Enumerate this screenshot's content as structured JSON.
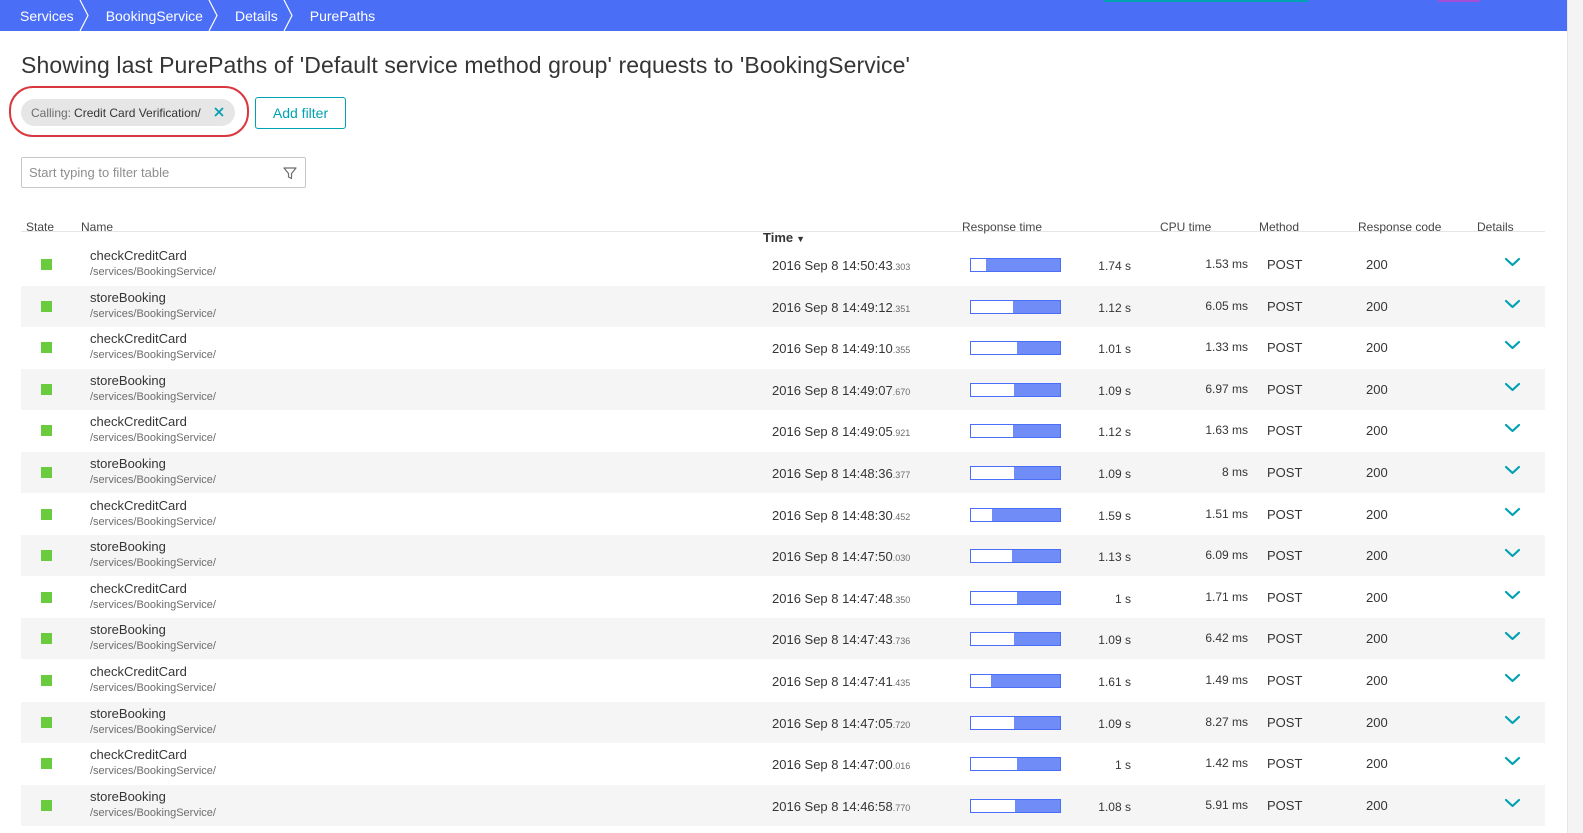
{
  "breadcrumb": [
    {
      "label": "Services"
    },
    {
      "label": "BookingService"
    },
    {
      "label": "Details"
    },
    {
      "label": "PurePaths"
    }
  ],
  "colors": {
    "topbar": "#4a6ef5",
    "accent": "#00a1b2",
    "highlight": "#d9383e",
    "state_ok": "#6bcb3f",
    "bar_fill": "#6f8cf7"
  },
  "page": {
    "title": "Showing last PurePaths of 'Default service method group' requests to 'BookingService'"
  },
  "filter_chip": {
    "key": "Calling:",
    "value": "Credit Card Verification/",
    "close_icon": "close-icon"
  },
  "add_filter_label": "Add filter",
  "search": {
    "placeholder": "Start typing to filter table",
    "icon": "funnel-icon"
  },
  "table": {
    "headers": {
      "state": "State",
      "name": "Name",
      "time": "Time",
      "response_time": "Response time",
      "cpu_time": "CPU time",
      "method": "Method",
      "response_code": "Response code",
      "details": "Details"
    },
    "sorted_by": "time",
    "sort_direction": "descending",
    "rows": [
      {
        "name": "checkCreditCard",
        "path": "/services/BookingService/",
        "time": "2016 Sep 8 14:50:43",
        "ms": ".303",
        "response_time": "1.74 s",
        "bar_fraction": 0.83,
        "cpu_time": "1.53 ms",
        "method": "POST",
        "code": "200"
      },
      {
        "name": "storeBooking",
        "path": "/services/BookingService/",
        "time": "2016 Sep 8 14:49:12",
        "ms": ".351",
        "response_time": "1.12 s",
        "bar_fraction": 0.53,
        "cpu_time": "6.05 ms",
        "method": "POST",
        "code": "200"
      },
      {
        "name": "checkCreditCard",
        "path": "/services/BookingService/",
        "time": "2016 Sep 8 14:49:10",
        "ms": ".355",
        "response_time": "1.01 s",
        "bar_fraction": 0.48,
        "cpu_time": "1.33 ms",
        "method": "POST",
        "code": "200"
      },
      {
        "name": "storeBooking",
        "path": "/services/BookingService/",
        "time": "2016 Sep 8 14:49:07",
        "ms": ".670",
        "response_time": "1.09 s",
        "bar_fraction": 0.52,
        "cpu_time": "6.97 ms",
        "method": "POST",
        "code": "200"
      },
      {
        "name": "checkCreditCard",
        "path": "/services/BookingService/",
        "time": "2016 Sep 8 14:49:05",
        "ms": ".921",
        "response_time": "1.12 s",
        "bar_fraction": 0.53,
        "cpu_time": "1.63 ms",
        "method": "POST",
        "code": "200"
      },
      {
        "name": "storeBooking",
        "path": "/services/BookingService/",
        "time": "2016 Sep 8 14:48:36",
        "ms": ".377",
        "response_time": "1.09 s",
        "bar_fraction": 0.52,
        "cpu_time": "8 ms",
        "method": "POST",
        "code": "200"
      },
      {
        "name": "checkCreditCard",
        "path": "/services/BookingService/",
        "time": "2016 Sep 8 14:48:30",
        "ms": ".452",
        "response_time": "1.59 s",
        "bar_fraction": 0.76,
        "cpu_time": "1.51 ms",
        "method": "POST",
        "code": "200"
      },
      {
        "name": "storeBooking",
        "path": "/services/BookingService/",
        "time": "2016 Sep 8 14:47:50",
        "ms": ".030",
        "response_time": "1.13 s",
        "bar_fraction": 0.54,
        "cpu_time": "6.09 ms",
        "method": "POST",
        "code": "200"
      },
      {
        "name": "checkCreditCard",
        "path": "/services/BookingService/",
        "time": "2016 Sep 8 14:47:48",
        "ms": ".350",
        "response_time": "1 s",
        "bar_fraction": 0.48,
        "cpu_time": "1.71 ms",
        "method": "POST",
        "code": "200"
      },
      {
        "name": "storeBooking",
        "path": "/services/BookingService/",
        "time": "2016 Sep 8 14:47:43",
        "ms": ".736",
        "response_time": "1.09 s",
        "bar_fraction": 0.52,
        "cpu_time": "6.42 ms",
        "method": "POST",
        "code": "200"
      },
      {
        "name": "checkCreditCard",
        "path": "/services/BookingService/",
        "time": "2016 Sep 8 14:47:41",
        "ms": ".435",
        "response_time": "1.61 s",
        "bar_fraction": 0.77,
        "cpu_time": "1.49 ms",
        "method": "POST",
        "code": "200"
      },
      {
        "name": "storeBooking",
        "path": "/services/BookingService/",
        "time": "2016 Sep 8 14:47:05",
        "ms": ".720",
        "response_time": "1.09 s",
        "bar_fraction": 0.52,
        "cpu_time": "8.27 ms",
        "method": "POST",
        "code": "200"
      },
      {
        "name": "checkCreditCard",
        "path": "/services/BookingService/",
        "time": "2016 Sep 8 14:47:00",
        "ms": ".016",
        "response_time": "1 s",
        "bar_fraction": 0.48,
        "cpu_time": "1.42 ms",
        "method": "POST",
        "code": "200"
      },
      {
        "name": "storeBooking",
        "path": "/services/BookingService/",
        "time": "2016 Sep 8 14:46:58",
        "ms": ".770",
        "response_time": "1.08 s",
        "bar_fraction": 0.51,
        "cpu_time": "5.91 ms",
        "method": "POST",
        "code": "200"
      }
    ]
  }
}
